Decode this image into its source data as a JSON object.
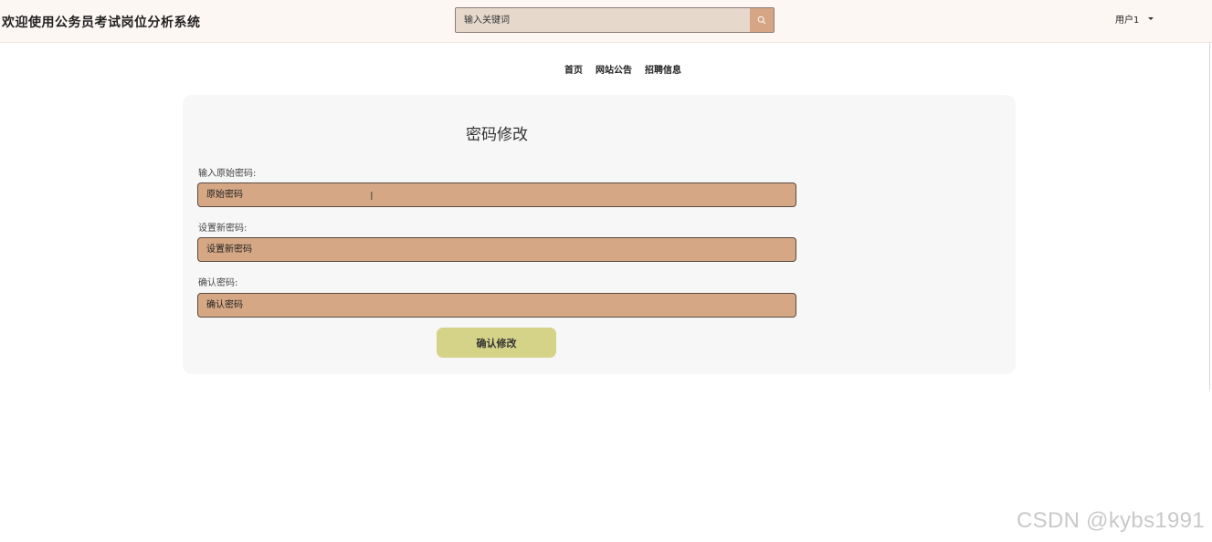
{
  "header": {
    "title": "欢迎使用公务员考试岗位分析系统",
    "search": {
      "placeholder": "输入关键词",
      "icon": "search-icon"
    },
    "user": {
      "name": "用户1"
    }
  },
  "nav": {
    "items": [
      "首页",
      "网站公告",
      "招聘信息"
    ]
  },
  "form": {
    "title": "密码修改",
    "fields": [
      {
        "label": "输入原始密码:",
        "placeholder": "原始密码"
      },
      {
        "label": "设置新密码:",
        "placeholder": "设置新密码"
      },
      {
        "label": "确认密码:",
        "placeholder": "确认密码"
      }
    ],
    "submit_label": "确认修改"
  },
  "watermark": "CSDN @kybs1991",
  "colors": {
    "field_bg": "#d6a784",
    "search_button": "#d5a585",
    "submit_button": "#d5d388",
    "card_bg": "#f7f7f7",
    "header_bg": "#fdf7f4"
  }
}
